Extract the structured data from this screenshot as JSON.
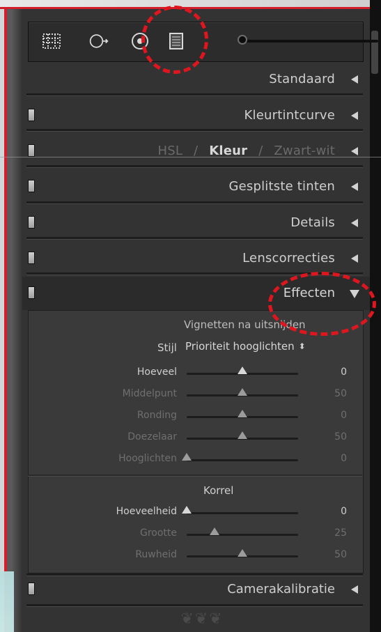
{
  "panel": {
    "sections": [
      {
        "key": "standaard",
        "title": "Standaard"
      },
      {
        "key": "kleurtintcurve",
        "title": "Kleurtintcurve"
      },
      {
        "key": "hsl",
        "title_parts": [
          "HSL",
          "/",
          "Kleur",
          "/",
          "Zwart-wit"
        ]
      },
      {
        "key": "gesplitste_tinten",
        "title": "Gesplitste tinten"
      },
      {
        "key": "details",
        "title": "Details"
      },
      {
        "key": "lenscorrecties",
        "title": "Lenscorrecties"
      },
      {
        "key": "effecten",
        "title": "Effecten"
      },
      {
        "key": "camerakalibratie",
        "title": "Camerakalibratie"
      }
    ],
    "effecten": {
      "vignette_header": "Vignetten na uitsnijden",
      "style_label": "Stijl",
      "style_value": "Prioriteit hooglichten",
      "style_arrows": "⬍",
      "vignette_rows": [
        {
          "label": "Hoeveel",
          "value": "0",
          "slider": 0.5,
          "enabled": true
        },
        {
          "label": "Middelpunt",
          "value": "50",
          "slider": 0.5,
          "enabled": false
        },
        {
          "label": "Ronding",
          "value": "0",
          "slider": 0.5,
          "enabled": false
        },
        {
          "label": "Doezelaar",
          "value": "50",
          "slider": 0.5,
          "enabled": false
        },
        {
          "label": "Hooglichten",
          "value": "0",
          "slider": 0.0,
          "enabled": false
        }
      ],
      "grain_header": "Korrel",
      "grain_rows": [
        {
          "label": "Hoeveelheid",
          "value": "0",
          "slider": 0.0,
          "enabled": true
        },
        {
          "label": "Grootte",
          "value": "25",
          "slider": 0.25,
          "enabled": false
        },
        {
          "label": "Ruwheid",
          "value": "50",
          "slider": 0.5,
          "enabled": false
        }
      ]
    },
    "toolbar": {
      "tools": [
        "grid-crop-tool",
        "spot-removal-tool",
        "red-eye-tool",
        "graduated-filter-tool"
      ],
      "brush_slider": "brush-size-slider"
    }
  },
  "colors": {
    "annotation": "#e0161f",
    "panel_bg": "#333333",
    "text": "#cfcfcf"
  }
}
